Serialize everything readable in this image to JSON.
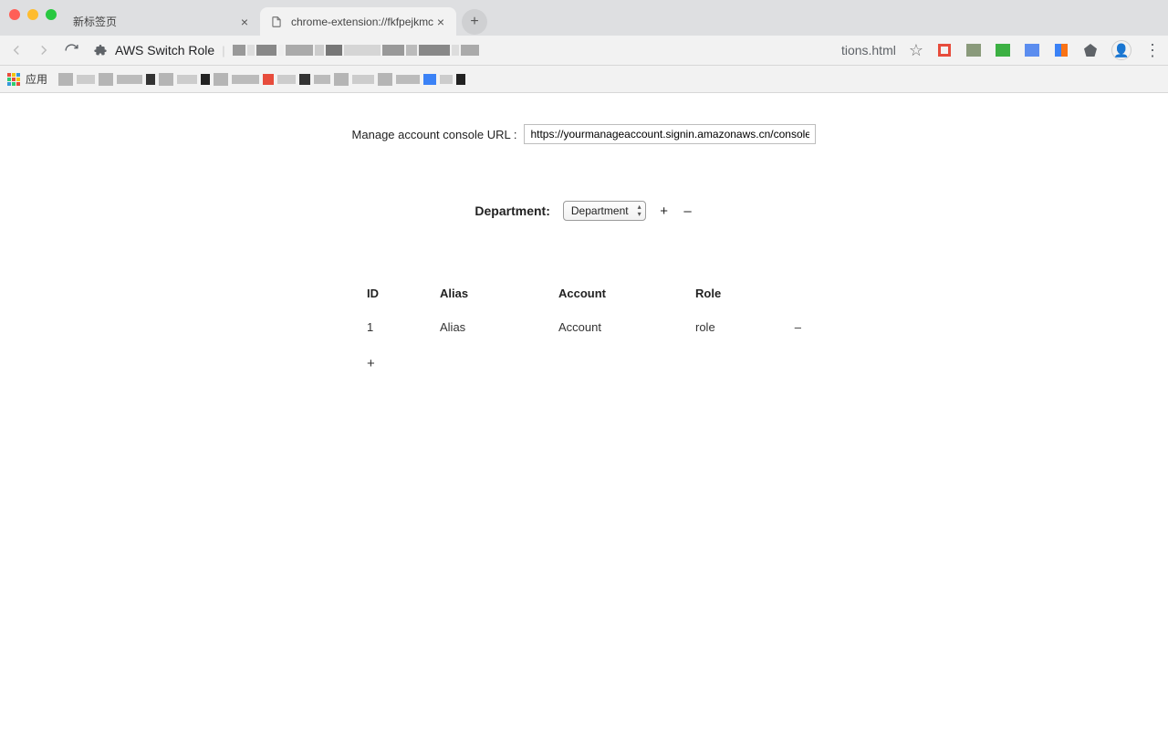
{
  "browser": {
    "tabs": [
      {
        "title": "新标签页",
        "active": false
      },
      {
        "title": "chrome-extension://fkfpejkmc",
        "active": true
      }
    ],
    "page_title_in_addr": "AWS Switch Role",
    "url_tail": "tions.html",
    "bookmarks_label": "应用"
  },
  "page": {
    "url_label": "Manage account console URL :",
    "url_value": "https://yourmanageaccount.signin.amazonaws.cn/console",
    "department_label": "Department:",
    "department_select": "Department",
    "plus": "+",
    "minus": "–",
    "table": {
      "headers": [
        "ID",
        "Alias",
        "Account",
        "Role"
      ],
      "row": {
        "id": "1",
        "alias": "Alias",
        "account": "Account",
        "role": "role",
        "remove": "–"
      },
      "add": "+"
    }
  }
}
